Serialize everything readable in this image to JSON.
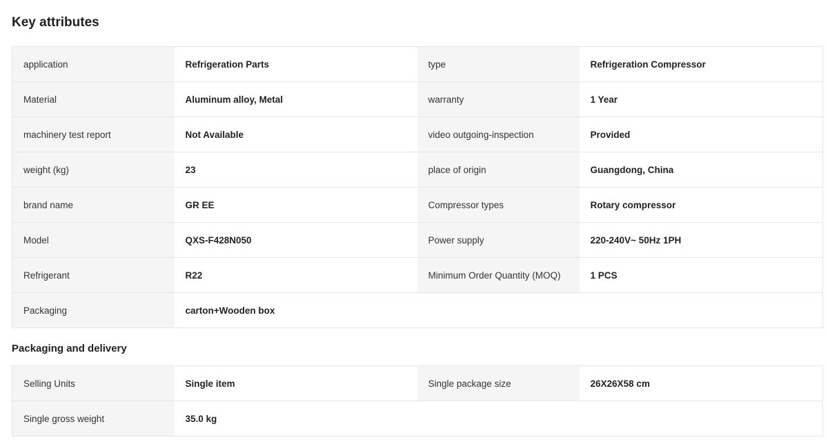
{
  "key_attributes": {
    "title": "Key attributes",
    "rows": [
      [
        {
          "k": "application",
          "v": "Refrigeration Parts"
        },
        {
          "k": "type",
          "v": "Refrigeration Compressor"
        }
      ],
      [
        {
          "k": "Material",
          "v": "Aluminum alloy, Metal"
        },
        {
          "k": "warranty",
          "v": "1 Year"
        }
      ],
      [
        {
          "k": "machinery test report",
          "v": "Not Available"
        },
        {
          "k": "video outgoing-inspection",
          "v": "Provided"
        }
      ],
      [
        {
          "k": "weight (kg)",
          "v": "23"
        },
        {
          "k": "place of origin",
          "v": "Guangdong, China"
        }
      ],
      [
        {
          "k": "brand name",
          "v": "GR EE"
        },
        {
          "k": "Compressor types",
          "v": "Rotary compressor"
        }
      ],
      [
        {
          "k": "Model",
          "v": "QXS-F428N050"
        },
        {
          "k": "Power supply",
          "v": "220-240V~ 50Hz 1PH"
        }
      ],
      [
        {
          "k": "Refrigerant",
          "v": "R22"
        },
        {
          "k": "Minimum Order Quantity (MOQ)",
          "v": "1 PCS"
        }
      ],
      [
        {
          "k": "Packaging",
          "v": "carton+Wooden box"
        }
      ]
    ]
  },
  "packaging_delivery": {
    "title": "Packaging and delivery",
    "rows": [
      [
        {
          "k": "Selling Units",
          "v": "Single item"
        },
        {
          "k": "Single package size",
          "v": "26X26X58 cm"
        }
      ],
      [
        {
          "k": "Single gross weight",
          "v": "35.0 kg"
        }
      ]
    ]
  }
}
